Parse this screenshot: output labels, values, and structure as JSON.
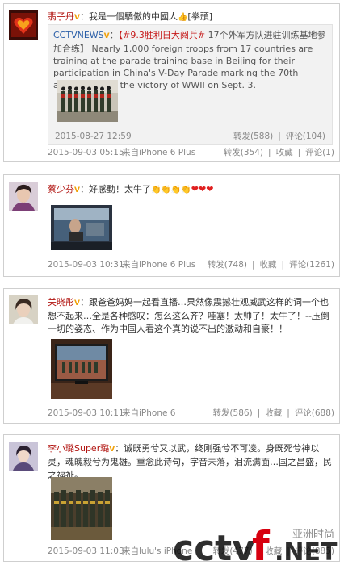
{
  "posts": [
    {
      "user": "翡子丹",
      "text": "我是一個驕傲的中國人",
      "text_tail": "[拳頭]",
      "repost": {
        "user": "CCTVNEWS",
        "tag": "【#9.3胜利日大阅兵#",
        "text_cn": "17个外军方队进驻训练基地参加合练】",
        "text_en": "Nearly 1,000 foreign troops from 17 countries are training at the parade training base in Beijing for their participation in China's V-Day Parade marking the 70th anniversary of the victory of WWII on Sept. 3.",
        "time": "2015-08-27 12:59",
        "forward_label": "转发(588)",
        "comment_label": "评论(104)"
      },
      "time": "2015-09-03 05:15",
      "source": "来自iPhone 6 Plus",
      "forward_label": "转发(354)",
      "favorite_label": "收藏",
      "comment_label": "评论(1)"
    },
    {
      "user": "蔡少芬",
      "text": "好感動！太牛了",
      "time": "2015-09-03 10:31",
      "source": "来自iPhone 6 Plus",
      "forward_label": "转发(748)",
      "favorite_label": "收藏",
      "comment_label": "评论(1261)"
    },
    {
      "user": "关晓彤",
      "text": "跟爸爸妈妈一起看直播…果然像震撼壮观威武这样的词一个也想不起来…全是各种感叹：怎么这么齐？哇塞！太帅了！太牛了！--压倒一切的姿态、作为中国人看这个真的说不出的激动和自豪！！",
      "time": "2015-09-03 10:11",
      "source": "来自iPhone 6",
      "forward_label": "转发(586)",
      "favorite_label": "收藏",
      "comment_label": "评论(688)"
    },
    {
      "user": "李小璐Super璐",
      "text": "诚既勇兮又以武，终刚强兮不可凌。身既死兮神以灵，魂魄毅兮为鬼雄。重念此诗句，字音未落，泪流满面…国之昌盛，民之福祉。",
      "time": "2015-09-03 11:03",
      "source": "来自lulu's iPhone",
      "forward_label": "转发(477)",
      "favorite_label": "收藏",
      "comment_label": "评论(885)"
    }
  ],
  "watermark": {
    "logo": "cctv",
    "logo_f": "f",
    "logo_net": ".NET",
    "cn": "亚洲时尚"
  },
  "colors": {
    "username": "#b1130f",
    "link": "#2b5fa8",
    "meta": "#888888",
    "border": "#cfcfcf",
    "watermark_red": "#d7000f"
  }
}
